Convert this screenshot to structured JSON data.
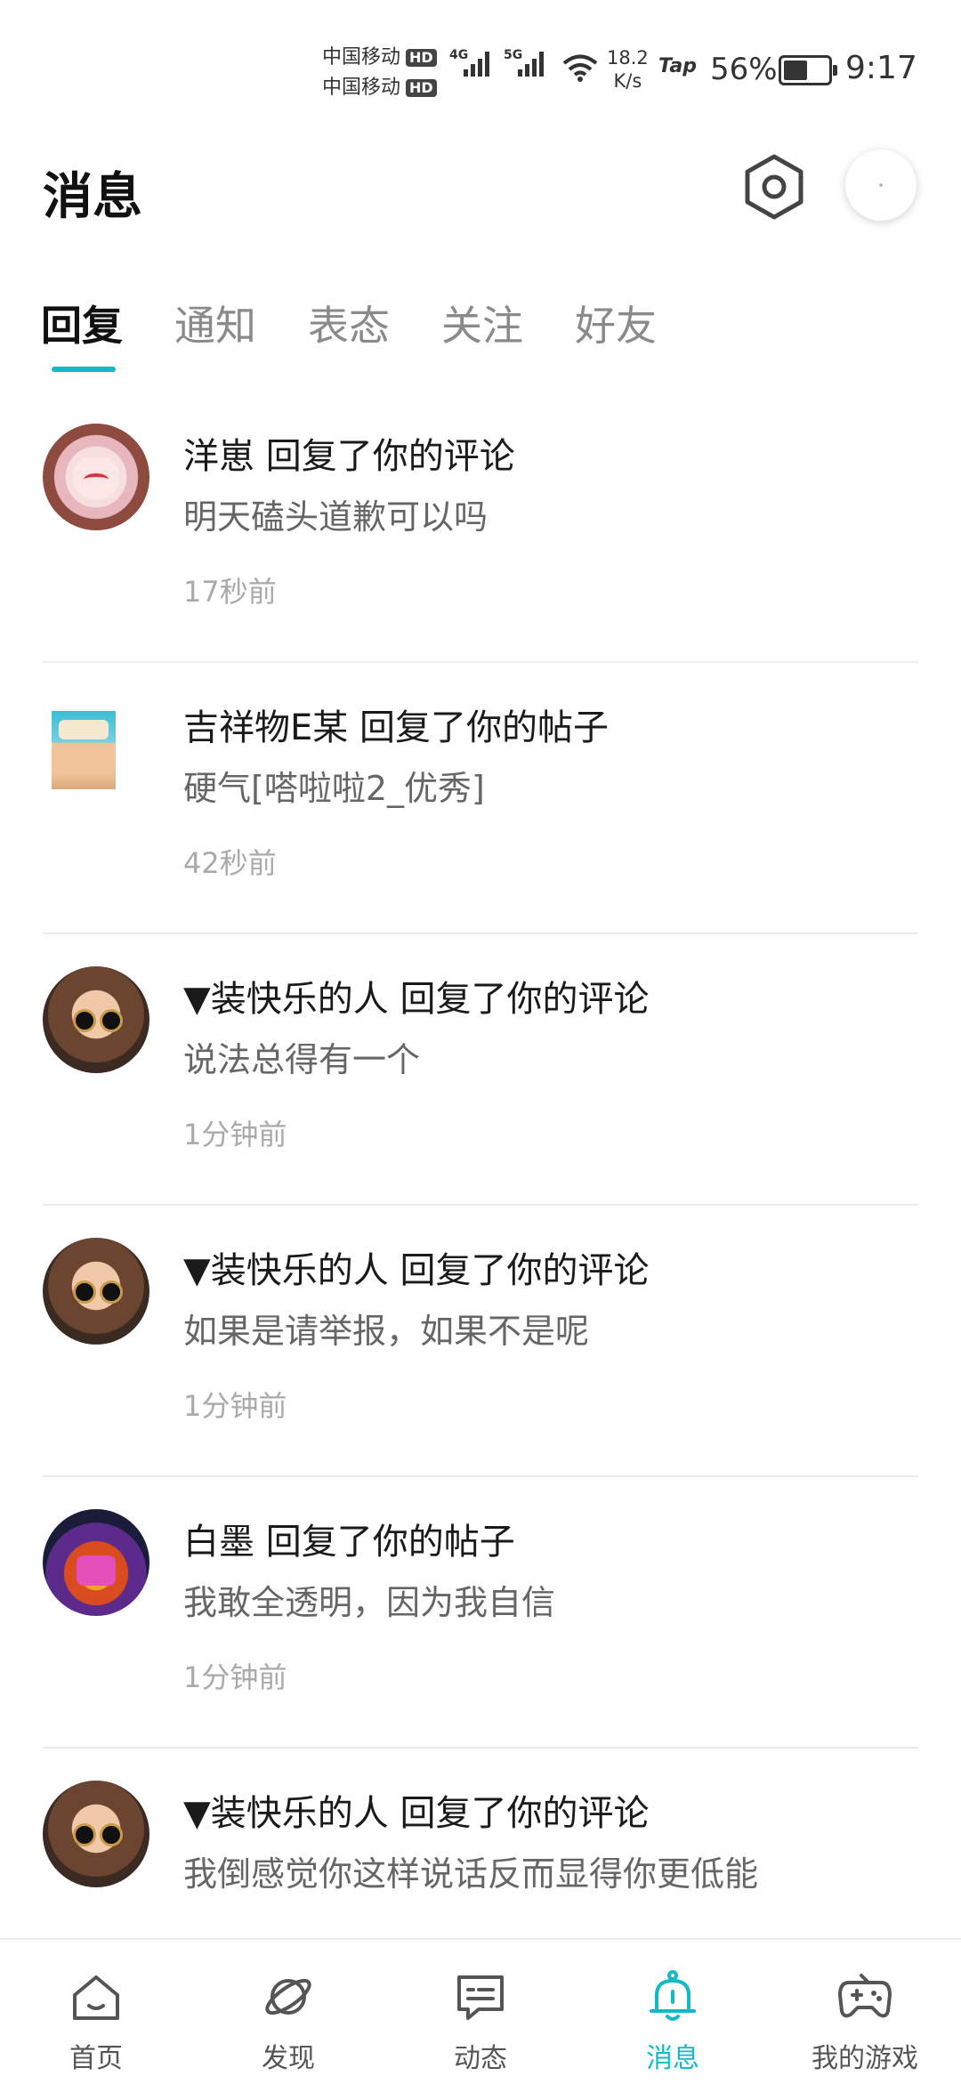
{
  "status_bar": {
    "carrier1": "中国移动",
    "carrier2": "中国移动",
    "hd": "HD",
    "sig1_tag": "4G",
    "sig2_tag": "5G",
    "net_speed_value": "18.2",
    "net_speed_unit": "K/s",
    "tap_logo": "Tap",
    "battery_percent": "56%",
    "battery_level": 0.56,
    "time": "9:17"
  },
  "header": {
    "title": "消息",
    "settings_icon": "hexagon-settings-icon",
    "avatar_icon": "user-avatar"
  },
  "tabs": [
    {
      "label": "回复",
      "active": true
    },
    {
      "label": "通知",
      "active": false
    },
    {
      "label": "表态",
      "active": false
    },
    {
      "label": "关注",
      "active": false
    },
    {
      "label": "好友",
      "active": false
    }
  ],
  "messages": [
    {
      "title": "洋崽 回复了你的评论",
      "body": "明天磕头道歉可以吗",
      "time": "17秒前"
    },
    {
      "title": "吉祥物E某 回复了你的帖子",
      "body": "硬气[嗒啦啦2_优秀]",
      "time": "42秒前"
    },
    {
      "title": "▼装快乐的人 回复了你的评论",
      "body": "说法总得有一个",
      "time": "1分钟前"
    },
    {
      "title": "▼装快乐的人 回复了你的评论",
      "body": "如果是请举报，如果不是呢",
      "time": "1分钟前"
    },
    {
      "title": "白墨 回复了你的帖子",
      "body": "我敢全透明，因为我自信",
      "time": "1分钟前"
    },
    {
      "title": "▼装快乐的人 回复了你的评论",
      "body": "我倒感觉你这样说话反而显得你更低能",
      "time": ""
    }
  ],
  "bottom_nav": [
    {
      "label": "首页",
      "icon": "home-icon",
      "active": false
    },
    {
      "label": "发现",
      "icon": "planet-icon",
      "active": false
    },
    {
      "label": "动态",
      "icon": "chat-icon",
      "active": false
    },
    {
      "label": "消息",
      "icon": "bell-icon",
      "active": true
    },
    {
      "label": "我的游戏",
      "icon": "gamepad-icon",
      "active": false
    }
  ],
  "colors": {
    "accent": "#14b9c8",
    "text": "#1a1a1a",
    "muted": "#aaaaaa"
  }
}
